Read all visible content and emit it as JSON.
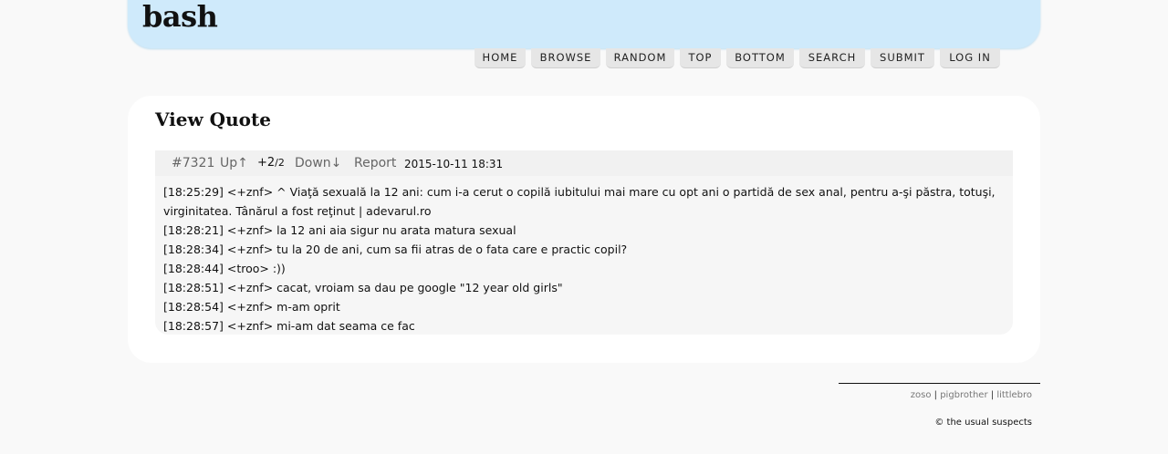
{
  "site": {
    "logo": "bash"
  },
  "nav": [
    "HOME",
    "BROWSE",
    "RANDOM",
    "TOP",
    "BOTTOM",
    "SEARCH",
    "SUBMIT",
    "LOG IN"
  ],
  "panel": {
    "title": "View Quote"
  },
  "quote": {
    "id": "#7321",
    "up": "Up↑",
    "score": "+2",
    "votes": "/2",
    "down": "Down↓",
    "report": "Report",
    "date": "2015-10-11 18:31",
    "lines": [
      "[18:25:29]  <+znf>  ^ Viaţă sexuală la 12 ani: cum i-a cerut o copilă iubitului mai mare cu opt ani o partidă de sex anal, pentru a-şi păstra, totuşi, virginitatea. Tânărul a fost reţinut | adevarul.ro",
      "[18:28:21]  <+znf>  la 12 ani aia sigur nu arata matura sexual",
      "[18:28:34]  <+znf>  tu la 20 de ani, cum sa fii atras de o fata care e practic copil?",
      "[18:28:44]  <troo>  :))",
      "[18:28:51]  <+znf>  cacat, vroiam sa dau pe google \"12 year old girls\"",
      "[18:28:54]  <+znf>  m-am oprit",
      "[18:28:57]  <+znf>  mi-am dat seama ce fac"
    ]
  },
  "footer": {
    "links": [
      "zoso",
      "pigbrother",
      "littlebro"
    ],
    "separator": "|",
    "copyright": "© the usual suspects"
  }
}
